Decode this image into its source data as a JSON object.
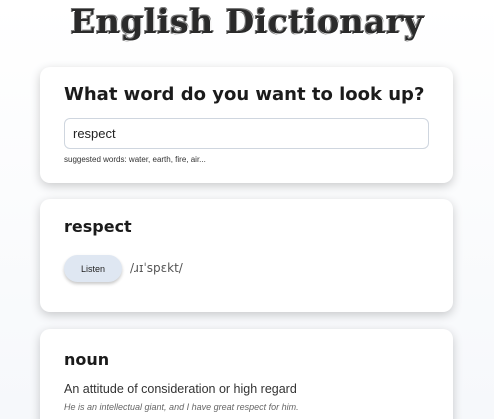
{
  "header": {
    "title": "English Dictionary"
  },
  "search": {
    "heading": "What word do you want to look up?",
    "value": "respect",
    "suggestions": "suggested words: water, earth, fire, air..."
  },
  "word": {
    "term": "respect",
    "listen_label": "Listen",
    "phonetic": "/ɹɪˈspɛkt/"
  },
  "meaning": {
    "part_of_speech": "noun",
    "definition": "An attitude of consideration or high regard",
    "example": "He is an intellectual giant, and I have great respect for him."
  }
}
